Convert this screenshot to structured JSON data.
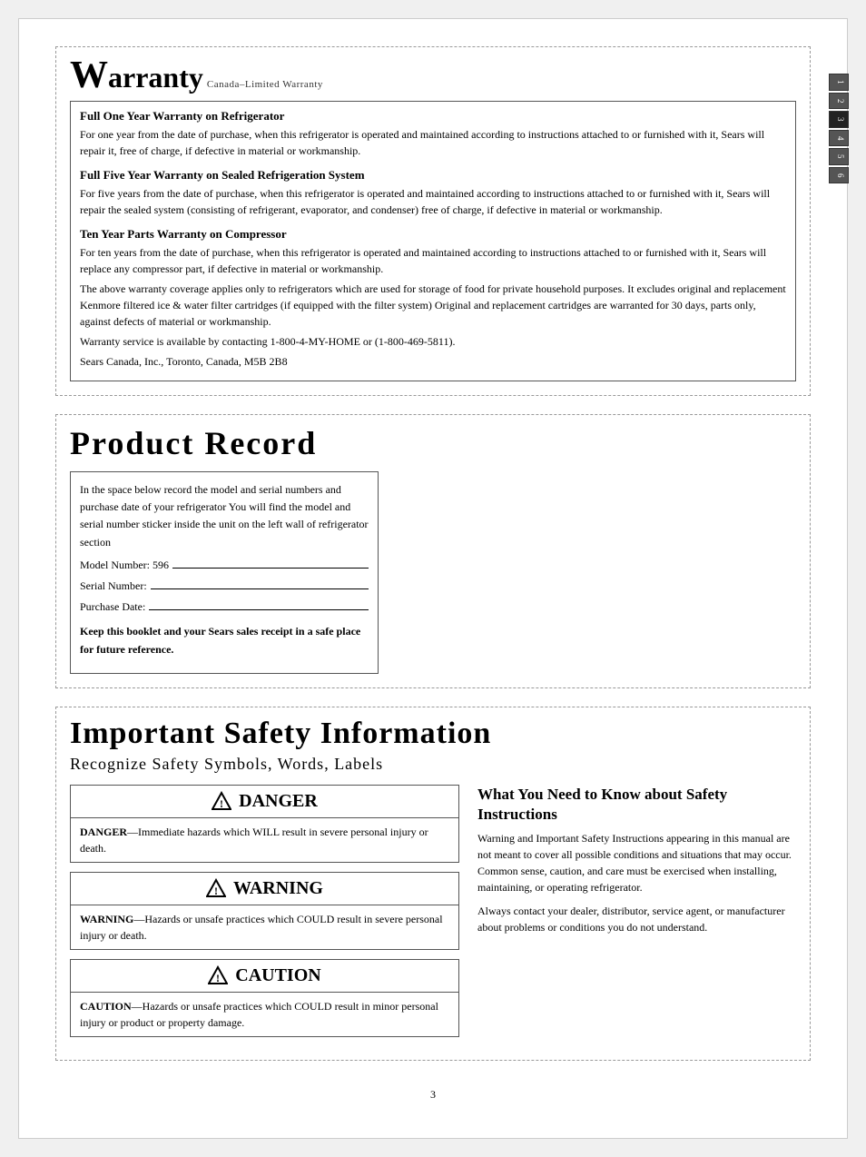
{
  "warranty": {
    "title_prefix": "W",
    "title_rest": "arranty",
    "subtitle": "Canada–Limited Warranty",
    "items": [
      {
        "heading": "Full One Year Warranty on Refrigerator",
        "text": "For one year from the date of purchase, when this refrigerator is operated and maintained according to instructions attached to or furnished with it, Sears will repair it, free of charge, if defective in material or workmanship."
      },
      {
        "heading": "Full Five Year Warranty on Sealed Refrigeration System",
        "text": "For five years from the date of purchase, when this refrigerator is operated and maintained according to instructions attached to or furnished with it, Sears will repair the sealed system (consisting of refrigerant, evaporator, and condenser) free of charge, if defective in material or workmanship."
      },
      {
        "heading": "Ten Year Parts Warranty on Compressor",
        "text": "For ten years from the date of purchase, when this refrigerator is operated and maintained according to instructions attached to or furnished with it, Sears will replace any compressor part, if defective in material or workmanship."
      },
      {
        "heading": "",
        "text": "The above warranty coverage applies only to refrigerators which are used for storage of food for private household purposes.  It excludes original and replacement Kenmore filtered ice & water filter cartridges (if equipped with the filter system)  Original and replacement cartridges are warranted for 30 days, parts only, against defects of material or workmanship."
      },
      {
        "heading": "",
        "text": "Warranty service is available by contacting 1-800-4-MY-HOME or (1-800-469-5811)."
      },
      {
        "heading": "",
        "text": "Sears Canada, Inc., Toronto, Canada, M5B 2B8"
      }
    ]
  },
  "product_record": {
    "title": "Product  Record",
    "description": "In the space below record the model and serial numbers and purchase date of your refrigerator  You will find the model and serial number sticker inside the unit on the left wall of refrigerator section",
    "fields": [
      {
        "label": "Model Number:  596",
        "has_line": true
      },
      {
        "label": "Serial Number:",
        "has_line": true
      },
      {
        "label": "Purchase Date:",
        "has_line": true
      }
    ],
    "note": "Keep this booklet and your Sears sales receipt in a safe place for future reference."
  },
  "safety": {
    "title": "Important Safety Information",
    "subtitle": "Recognize Safety Symbols, Words, Labels",
    "alerts": [
      {
        "type": "DANGER",
        "body_prefix": "DANGER",
        "body_text": "—Immediate hazards which WILL result in severe personal injury or death."
      },
      {
        "type": "WARNING",
        "body_prefix": "WARNING",
        "body_text": "—Hazards or unsafe practices which COULD result in severe personal injury or death."
      },
      {
        "type": "CAUTION",
        "body_prefix": "CAUTION",
        "body_text": "—Hazards or unsafe practices which COULD result in minor personal injury or product or property damage."
      }
    ],
    "right_title": "What You Need to Know about Safety Instructions",
    "right_paragraphs": [
      "Warning and Important Safety Instructions appearing in this manual are not meant to cover all possible conditions and situations that may occur. Common sense, caution, and care must be exercised when installing, maintaining, or operating refrigerator.",
      "Always contact your dealer, distributor, service agent, or manufacturer about problems or conditions you do not understand."
    ]
  },
  "sidebar_tabs": [
    "1",
    "2",
    "3",
    "4",
    "5",
    "6"
  ],
  "page_number": "3"
}
